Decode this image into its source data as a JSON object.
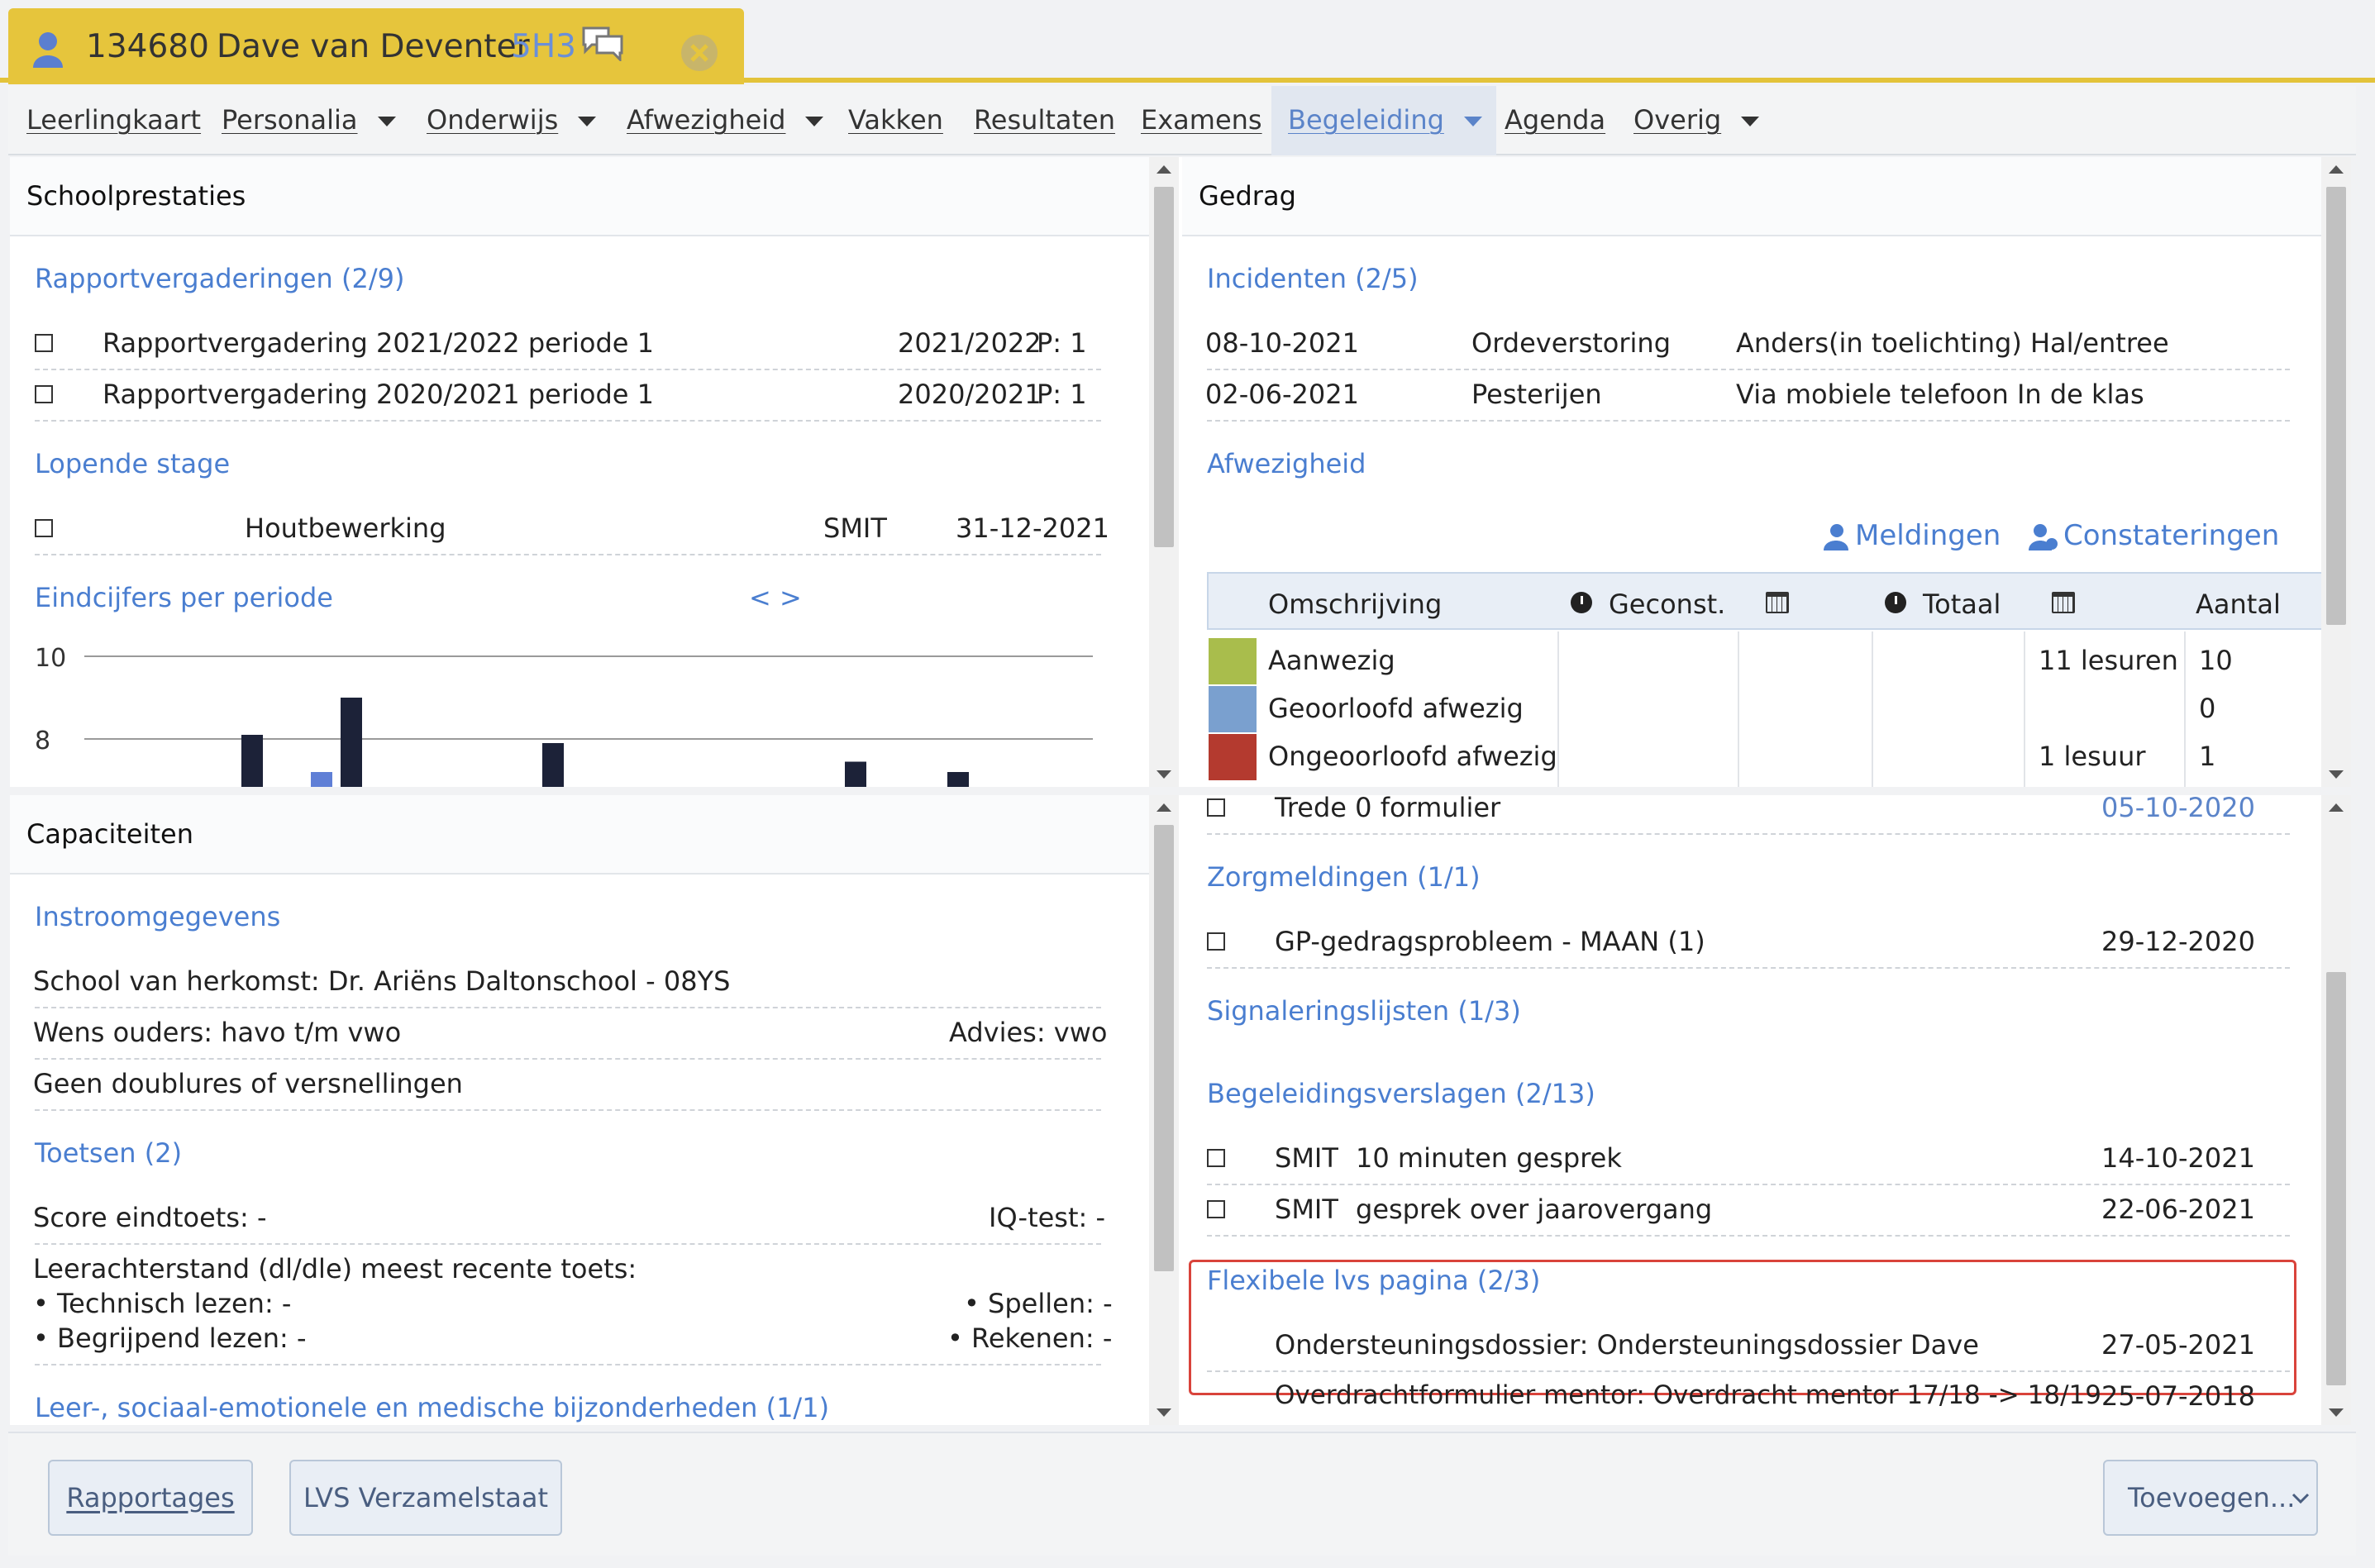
{
  "student": {
    "number": "134680",
    "name": "Dave van Deventer",
    "class": "5H3"
  },
  "nav": [
    {
      "label": "Leerlingkaart",
      "dropdown": false
    },
    {
      "label": "Personalia",
      "dropdown": true
    },
    {
      "label": "Onderwijs",
      "dropdown": true
    },
    {
      "label": "Afwezigheid",
      "dropdown": true
    },
    {
      "label": "Vakken",
      "dropdown": false
    },
    {
      "label": "Resultaten",
      "dropdown": false
    },
    {
      "label": "Examens",
      "dropdown": false
    },
    {
      "label": "Begeleiding",
      "dropdown": true,
      "active": true
    },
    {
      "label": "Agenda",
      "dropdown": false
    },
    {
      "label": "Overig",
      "dropdown": true
    }
  ],
  "school": {
    "title": "Schoolprestaties",
    "rapport_title": "Rapportvergaderingen (2/9)",
    "rapport": [
      {
        "label": "Rapportvergadering 2021/2022 periode 1",
        "year": "2021/2022",
        "period": "P: 1"
      },
      {
        "label": "Rapportvergadering 2020/2021 periode 1",
        "year": "2020/2021",
        "period": "P: 1"
      }
    ],
    "stage_title": "Lopende stage",
    "stage": {
      "label": "Houtbewerking",
      "teacher": "SMIT",
      "date": "31-12-2021"
    },
    "eind_title": "Eindcijfers per periode",
    "eind_nav": "< >"
  },
  "chart_data": {
    "type": "bar",
    "title": "Eindcijfers per periode",
    "yticks": [
      "10",
      "8"
    ],
    "ylim": [
      7,
      10
    ],
    "series": [
      {
        "color": "#1c2238",
        "values": [
          8.1,
          9.0,
          7.9,
          7.45,
          7.2
        ]
      },
      {
        "color": "#5f7fd6",
        "values": [
          7.2
        ]
      }
    ]
  },
  "capaciteiten": {
    "title": "Capaciteiten",
    "instroom_title": "Instroomgegevens",
    "herkomst": "School van herkomst: Dr. Ariëns Daltonschool - 08YS",
    "wens": "Wens ouders: havo t/m vwo",
    "advies": "Advies: vwo",
    "doublures": "Geen doublures of versnellingen",
    "toetsen_title": "Toetsen (2)",
    "score": "Score eindtoets: -",
    "iq": "IQ-test: -",
    "leerachter": "Leerachterstand (dl/dle) meest recente toets:",
    "technisch": "• Technisch lezen: -",
    "spellen": "• Spellen: -",
    "begrijpend": "• Begrijpend lezen: -",
    "rekenen": "• Rekenen: -",
    "bijzonder_title": "Leer-, sociaal-emotionele en medische bijzonderheden (1/1)"
  },
  "gedrag": {
    "title": "Gedrag",
    "incidenten_title": "Incidenten (2/5)",
    "incidenten": [
      {
        "date": "08-10-2021",
        "type": "Ordeverstoring",
        "desc": "Anders(in toelichting) Hal/entree"
      },
      {
        "date": "02-06-2021",
        "type": "Pesterijen",
        "desc": "Via mobiele telefoon  In de klas"
      }
    ],
    "afwezig_title": "Afwezigheid",
    "meldingen": "Meldingen",
    "constateringen": "Constateringen",
    "table_headers": {
      "omschrijving": "Omschrijving",
      "geconst": "Geconst.",
      "totaal": "Totaal",
      "aantal": "Aantal"
    },
    "rows": [
      {
        "label": "Aanwezig",
        "color": "#a9bd4c",
        "lesuren": "11 lesuren",
        "aantal": "10"
      },
      {
        "label": "Geoorloofd afwezig",
        "color": "#7aa0cf",
        "lesuren": "",
        "aantal": "0"
      },
      {
        "label": "Ongeoorloofd afwezig",
        "color": "#b43a2f",
        "lesuren": "1 lesuur",
        "aantal": "1"
      }
    ]
  },
  "zorg": {
    "trede": {
      "label": "Trede 0 formulier",
      "date": "05-10-2020"
    },
    "zorg_title": "Zorgmeldingen (1/1)",
    "zorg_item": {
      "label": "GP-gedragsprobleem - MAAN (1)",
      "date": "29-12-2020"
    },
    "signal_title": "Signaleringslijsten (1/3)",
    "verslag_title": "Begeleidingsverslagen (2/13)",
    "verslagen": [
      {
        "who": "SMIT",
        "label": "10 minuten gesprek",
        "date": "14-10-2021"
      },
      {
        "who": "SMIT",
        "label": "gesprek over jaarovergang",
        "date": "22-06-2021"
      }
    ],
    "flex_title": "Flexibele lvs pagina (2/3)",
    "flex": [
      {
        "label": "Ondersteuningsdossier: Ondersteuningsdossier Dave",
        "date": "27-05-2021"
      },
      {
        "label": "Overdrachtformulier mentor: Overdracht mentor 17/18 -> 18/19",
        "date": "25-07-2018"
      }
    ]
  },
  "footer": {
    "rapportages": "Rapportages",
    "verzamelstaat": "LVS Verzamelstaat",
    "toevoegen": "Toevoegen..."
  },
  "colors": {
    "accent": "#e6c53c",
    "link": "#4a7ed0",
    "highlight": "#d9433b"
  }
}
